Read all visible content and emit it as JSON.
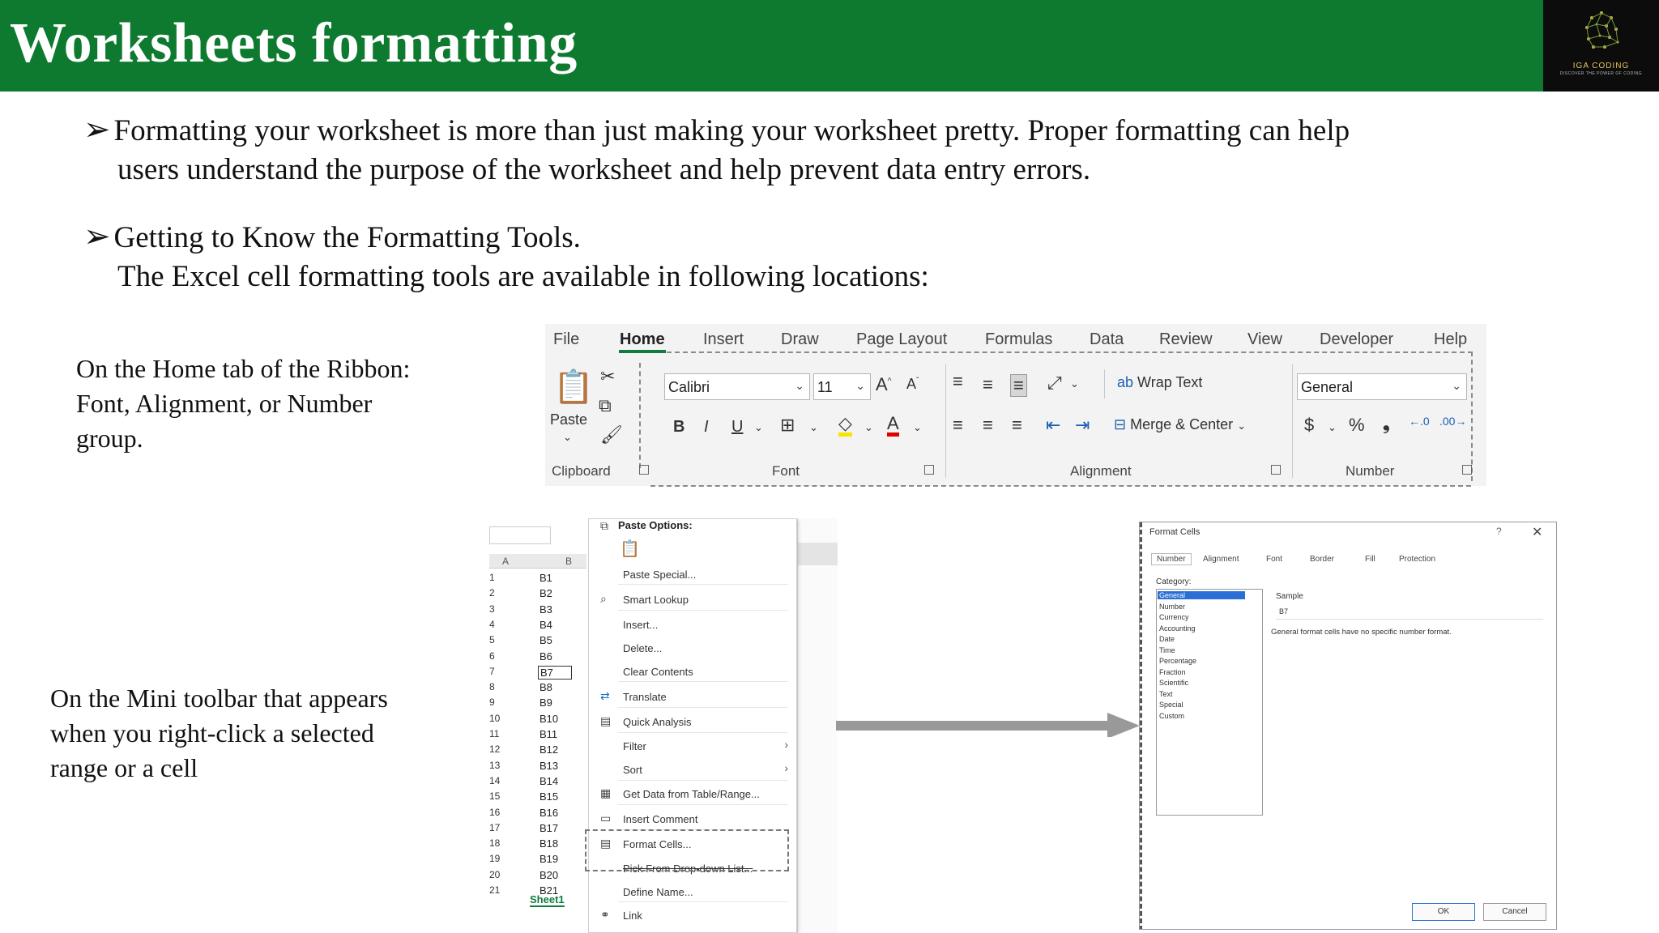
{
  "title": "Worksheets formatting",
  "logo": {
    "name": "IGA CODING",
    "tagline": "DISCOVER THE POWER OF CODING"
  },
  "bullets": [
    {
      "marker": "➢",
      "line1": "Formatting your worksheet is more than just making your worksheet pretty. Proper formatting can help",
      "line2": "users understand the purpose of the worksheet and help prevent data entry errors."
    },
    {
      "marker": "➢",
      "line1": "Getting to Know the Formatting Tools.",
      "line2": "The Excel cell formatting tools are available in following locations:"
    }
  ],
  "locations": {
    "ribbon_text": [
      "On the Home tab of the Ribbon:",
      "Font, Alignment, or Number",
      "group."
    ],
    "mini_text": [
      "On the Mini toolbar that appears",
      "when you right-click a selected",
      "range or a cell"
    ]
  },
  "ribbon": {
    "tabs": [
      "File",
      "Home",
      "Insert",
      "Draw",
      "Page Layout",
      "Formulas",
      "Data",
      "Review",
      "View",
      "Developer",
      "Help"
    ],
    "active_tab": "Home",
    "paste_label": "Paste",
    "font_name": "Calibri",
    "font_size": "11",
    "wrap_text": "Wrap Text",
    "merge_center": "Merge & Center",
    "number_format": "General",
    "groups": [
      "Clipboard",
      "Font",
      "Alignment",
      "Number"
    ],
    "accent_color": "#107c41"
  },
  "context_menu": {
    "column_headers": [
      "A",
      "B"
    ],
    "row_numbers": [
      "1",
      "2",
      "3",
      "4",
      "5",
      "6",
      "7",
      "8",
      "9",
      "10",
      "11",
      "12",
      "13",
      "14",
      "15",
      "16",
      "17",
      "18",
      "19",
      "20",
      "21"
    ],
    "cells": [
      "B1",
      "B2",
      "B3",
      "B4",
      "B5",
      "B6",
      "B7",
      "B8",
      "B9",
      "B10",
      "B11",
      "B12",
      "B13",
      "B14",
      "B15",
      "B16",
      "B17",
      "B18",
      "B19",
      "B20",
      "B21"
    ],
    "sheet_tab": "Sheet1",
    "items": {
      "paste_options": "Paste Options:",
      "paste_special": "Paste Special...",
      "smart_lookup": "Smart Lookup",
      "insert": "Insert...",
      "delete": "Delete...",
      "clear_contents": "Clear Contents",
      "translate": "Translate",
      "quick_analysis": "Quick Analysis",
      "filter": "Filter",
      "sort": "Sort",
      "get_data": "Get Data from Table/Range...",
      "insert_comment": "Insert Comment",
      "format_cells": "Format Cells...",
      "pick_list": "Pick From Drop-down List...",
      "define_name": "Define Name...",
      "link": "Link"
    }
  },
  "format_cells_dialog": {
    "title": "Format Cells",
    "help": "?",
    "close": "✕",
    "tabs": [
      "Number",
      "Alignment",
      "Font",
      "Border",
      "Fill",
      "Protection"
    ],
    "category_label": "Category:",
    "categories": [
      "General",
      "Number",
      "Currency",
      "Accounting",
      "Date",
      "Time",
      "Percentage",
      "Fraction",
      "Scientific",
      "Text",
      "Special",
      "Custom"
    ],
    "selected_category": "General",
    "sample_label": "Sample",
    "sample_value": "B7",
    "description": "General format cells have no specific number format.",
    "ok": "OK",
    "cancel": "Cancel"
  }
}
